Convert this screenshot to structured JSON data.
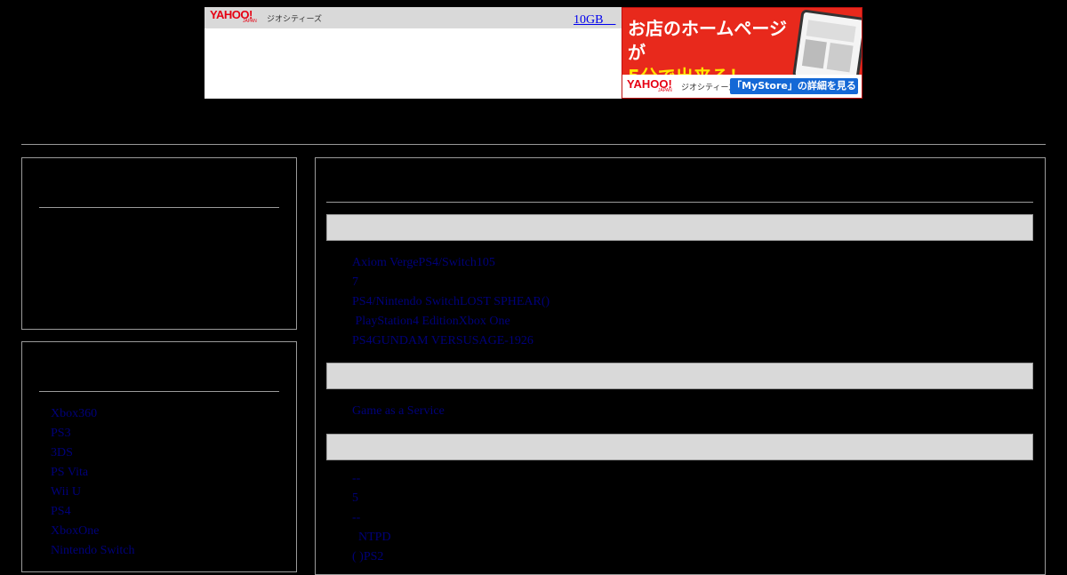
{
  "ad_banner": {
    "brand": "YAHOO!",
    "brand_sub": "JAPAN",
    "service": "ジオシティーズ",
    "storage_link": "10GB　",
    "promo_headline_line1": "お店のホームページが",
    "promo_headline_line2": "5分で出来る！",
    "promo_cta": "「MyStore」の詳細を見る"
  },
  "sidebar": {
    "categories": [
      "Xbox360",
      "PS3",
      "3DS",
      "PS Vita",
      "Wii U",
      "PS4",
      "XboxOne",
      "Nintendo Switch"
    ]
  },
  "main": {
    "section1_lines": [
      "Axiom VergePS4/Switch105",
      "7",
      "PS4/Nintendo SwitchLOST SPHEAR()",
      " PlayStation4 EditionXbox One",
      "PS4GUNDAM VERSUSAGE-1926"
    ],
    "section2_lines": [
      "Game as a Service"
    ],
    "section3_lines": [
      "--",
      "5",
      "--",
      "  NTPD",
      "( )PS2"
    ]
  },
  "colors": {
    "background": "#000000",
    "text": "#00007a",
    "section_bar": "#d9d9d9",
    "border": "#9a9a9a",
    "ad_red": "#e8291c",
    "ad_cta_blue": "#1468d6"
  }
}
